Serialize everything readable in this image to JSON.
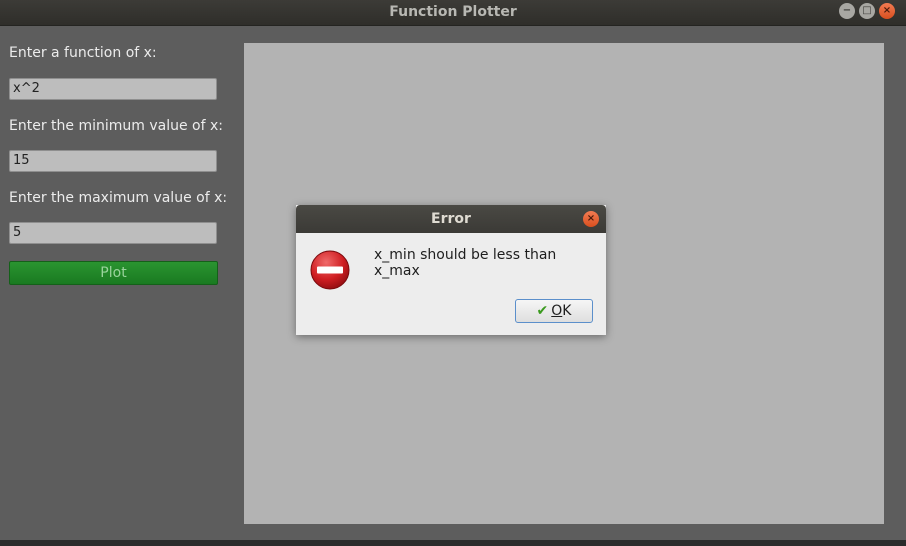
{
  "window": {
    "title": "Function Plotter",
    "controls": {
      "minimize": "−",
      "maximize": "□",
      "close": "×"
    }
  },
  "form": {
    "function_label": "Enter a function of x:",
    "function_value": "x^2",
    "min_label": "Enter the minimum value of x:",
    "min_value": "15",
    "max_label": "Enter the maximum value of x:",
    "max_value": "5",
    "plot_button": "Plot"
  },
  "dialog": {
    "title": "Error",
    "close": "×",
    "message": "x_min should be less than x_max",
    "ok_accel": "O",
    "ok_rest": "K",
    "icon": "error-icon"
  },
  "colors": {
    "accent_green": "#1f8a25",
    "error_red": "#c8191e",
    "canvas_bg": "#b3b3b3"
  }
}
